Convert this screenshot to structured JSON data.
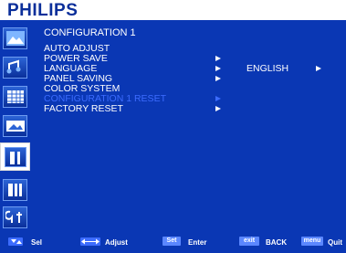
{
  "brand": "PHILIPS",
  "panel": {
    "title": "CONFIGURATION 1"
  },
  "menu": {
    "items": [
      {
        "label": "AUTO ADJUST",
        "has_arrow": false,
        "value": ""
      },
      {
        "label": "POWER SAVE",
        "has_arrow": true,
        "value": ""
      },
      {
        "label": "LANGUAGE",
        "has_arrow": true,
        "value": "ENGLISH"
      },
      {
        "label": "PANEL SAVING",
        "has_arrow": true,
        "value": ""
      },
      {
        "label": "COLOR SYSTEM",
        "has_arrow": false,
        "value": ""
      },
      {
        "label": "CONFIGURATION 1 RESET",
        "has_arrow": true,
        "value": "",
        "disabled": true
      },
      {
        "label": "FACTORY RESET",
        "has_arrow": true,
        "value": ""
      }
    ]
  },
  "sidebar": {
    "icons": [
      "picture-icon",
      "audio-icon",
      "schedule-icon",
      "image-settings-icon",
      "configuration-1-icon",
      "configuration-2-icon",
      "advanced-option-icon"
    ],
    "active_index": 4
  },
  "footer": {
    "sel": "Sel",
    "adjust": "Adjust",
    "set_key": "Set",
    "enter": "Enter",
    "exit_key": "exit",
    "back": "BACK",
    "menu_key": "menu",
    "quit": "Quit"
  },
  "colors": {
    "background": "#0a37b4",
    "brand_text": "#0b2f9a",
    "disabled_text": "#3c6cff",
    "key_chip": "#5b87ff"
  }
}
